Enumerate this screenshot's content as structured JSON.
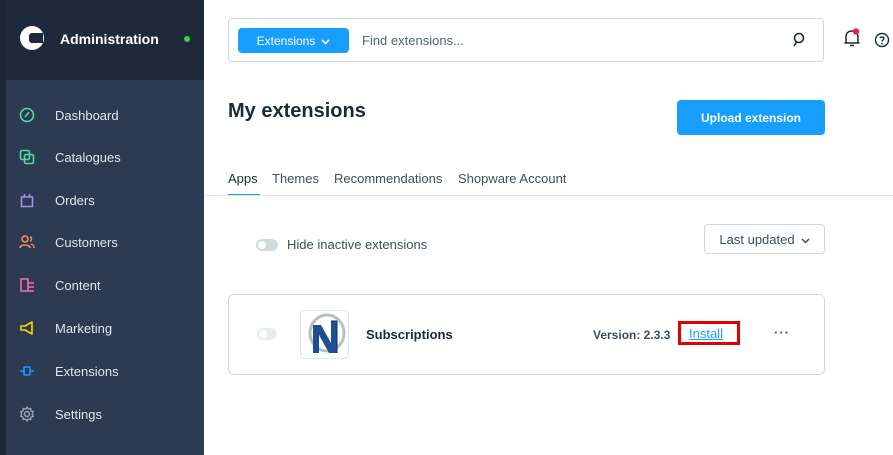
{
  "sidebar": {
    "title": "Administration",
    "status_color": "#37d046",
    "items": [
      {
        "label": "Dashboard",
        "icon": "dashboard-icon",
        "color": "#57d9a3"
      },
      {
        "label": "Catalogues",
        "icon": "catalogues-icon",
        "color": "#57d9a3"
      },
      {
        "label": "Orders",
        "icon": "orders-icon",
        "color": "#a092f0"
      },
      {
        "label": "Customers",
        "icon": "customers-icon",
        "color": "#f88962"
      },
      {
        "label": "Content",
        "icon": "content-icon",
        "color": "#ff68b4"
      },
      {
        "label": "Marketing",
        "icon": "marketing-icon",
        "color": "#ffd700"
      },
      {
        "label": "Extensions",
        "icon": "extensions-icon",
        "color": "#189eff"
      },
      {
        "label": "Settings",
        "icon": "settings-icon",
        "color": "#9aa8b5"
      }
    ]
  },
  "search": {
    "type_label": "Extensions",
    "placeholder": "Find extensions..."
  },
  "header": {
    "title": "My extensions",
    "upload_label": "Upload extension"
  },
  "tabs": [
    "Apps",
    "Themes",
    "Recommendations",
    "Shopware Account"
  ],
  "filters": {
    "hide_inactive_label": "Hide inactive extensions",
    "sort_label": "Last updated"
  },
  "extension": {
    "name": "Subscriptions",
    "version": "Version: 2.3.3",
    "install_label": "Install",
    "more_label": "···"
  },
  "colors": {
    "accent": "#189eff",
    "highlight_box": "#e00000",
    "sidebar_bg": "#2c3b51"
  }
}
